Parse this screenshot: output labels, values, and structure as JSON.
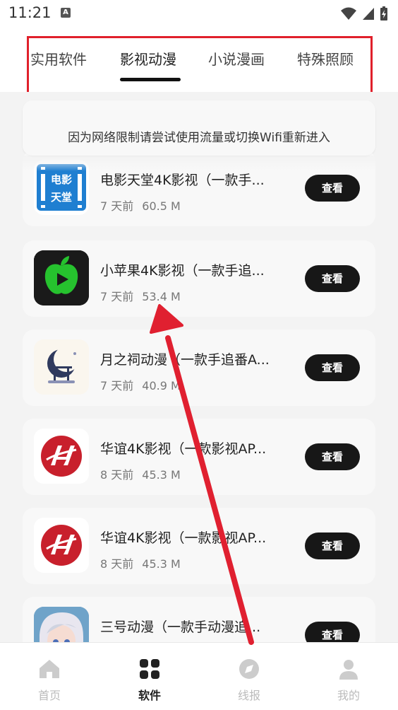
{
  "status": {
    "time": "11:21",
    "indicator": "A"
  },
  "tabs": [
    {
      "label": "实用软件",
      "active": false
    },
    {
      "label": "影视动漫",
      "active": true
    },
    {
      "label": "小说漫画",
      "active": false
    },
    {
      "label": "特殊照顾",
      "active": false
    }
  ],
  "notice": "因为网络限制请尝试使用流量或切换Wifi重新进入",
  "apps": [
    {
      "title": "电影天堂4K影视（一款手...",
      "age": "7 天前",
      "size": "60.5 M",
      "button": "查看",
      "icon": "movie-heaven-icon",
      "icon_text": [
        "电影",
        "天堂"
      ]
    },
    {
      "title": "小苹果4K影视（一款手追...",
      "age": "7 天前",
      "size": "53.4 M",
      "button": "查看",
      "icon": "green-apple-play-icon"
    },
    {
      "title": "月之祠动漫（一款手追番A...",
      "age": "7 天前",
      "size": "40.9 M",
      "button": "查看",
      "icon": "moon-shrine-icon"
    },
    {
      "title": "华谊4K影视（一款影视AP...",
      "age": "8 天前",
      "size": "45.3 M",
      "button": "查看",
      "icon": "huayi-logo-icon"
    },
    {
      "title": "华谊4K影视（一款影视AP...",
      "age": "8 天前",
      "size": "45.3 M",
      "button": "查看",
      "icon": "huayi-logo-icon"
    },
    {
      "title": "三号动漫（一款手动漫追...",
      "age": "",
      "size": "",
      "button": "查看",
      "icon": "anime-character-icon"
    }
  ],
  "nav": [
    {
      "label": "首页",
      "icon": "home-icon",
      "active": false
    },
    {
      "label": "软件",
      "icon": "grid-apps-icon",
      "active": true
    },
    {
      "label": "线报",
      "icon": "compass-icon",
      "active": false
    },
    {
      "label": "我的",
      "icon": "user-icon",
      "active": false
    }
  ],
  "colors": {
    "accent": "#171717",
    "highlight_border": "#e0202b",
    "arrow": "#e02030",
    "muted": "#777777"
  }
}
